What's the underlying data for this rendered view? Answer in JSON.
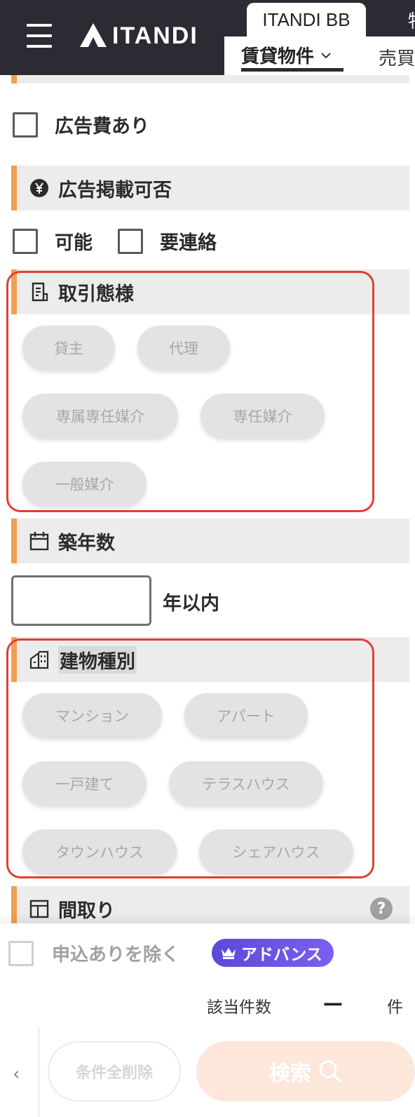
{
  "header": {
    "logo_text": "ITANDI",
    "tab_top_active": "ITANDI BB",
    "tab_top_next": "物",
    "subtab_active": "賃貸物件",
    "subtab_next": "売買"
  },
  "ad_fee": {
    "label": "広告費あり"
  },
  "ad_listing": {
    "title": "広告掲載可否",
    "options": [
      "可能",
      "要連絡"
    ]
  },
  "transaction": {
    "title": "取引態様",
    "options": [
      "貸主",
      "代理",
      "専属専任媒介",
      "専任媒介",
      "一般媒介"
    ]
  },
  "building_age": {
    "title": "築年数",
    "input_value": "",
    "suffix": "年以内"
  },
  "building_type": {
    "title": "建物種別",
    "options": [
      "マンション",
      "アパート",
      "一戸建て",
      "テラスハウス",
      "タウンハウス",
      "シェアハウス"
    ]
  },
  "layout": {
    "title": "間取り",
    "help": "?"
  },
  "bottom": {
    "exclude_label": "申込ありを除く",
    "advance_badge": "アドバンス",
    "count_label": "該当件数",
    "count_value": "ー",
    "count_unit": "件",
    "back": "‹",
    "clear_label": "条件全削除",
    "search_label": "検索"
  },
  "colors": {
    "header_bg": "#2c2a33",
    "accent_orange": "#f0a050",
    "highlight_red": "#e04030",
    "advance_purple": "#6a52e4",
    "search_disabled": "#fde7da"
  }
}
